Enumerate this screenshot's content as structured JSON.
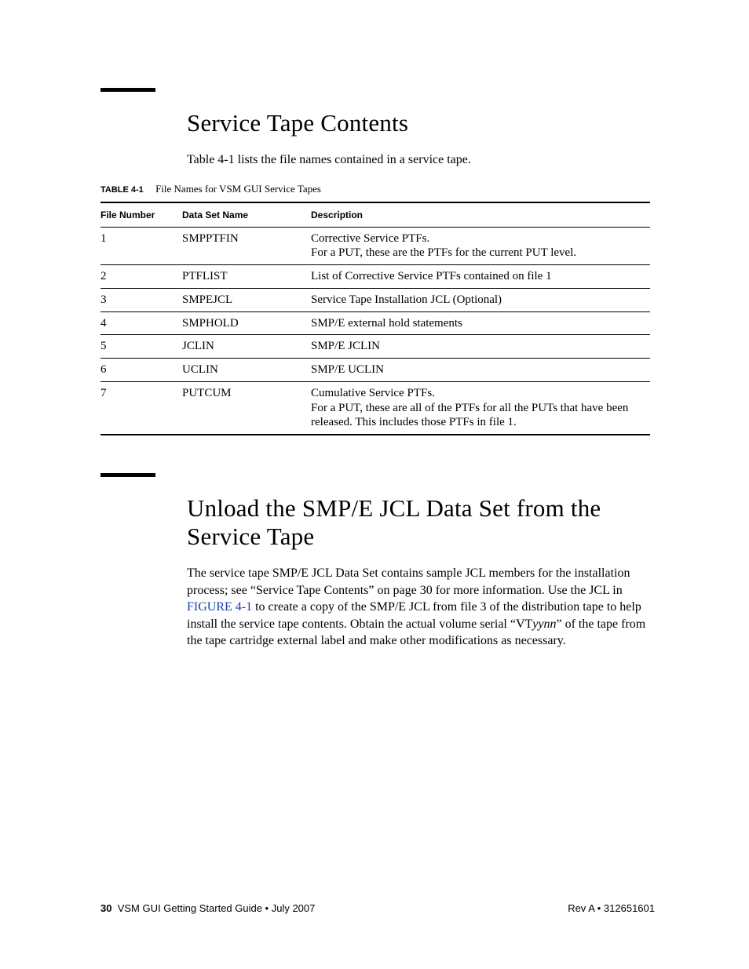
{
  "section1": {
    "title": "Service Tape Contents",
    "intro": "Table 4-1 lists the file names contained in a service tape.",
    "table_label": "TABLE 4-1",
    "table_caption": "File Names for VSM GUI Service Tapes",
    "headers": {
      "num": "File Number",
      "name": "Data Set Name",
      "desc": "Description"
    },
    "rows": [
      {
        "num": "1",
        "name": "SMPPTFIN",
        "desc": "Corrective Service PTFs.\nFor a PUT, these are the PTFs for the current PUT level."
      },
      {
        "num": "2",
        "name": "PTFLIST",
        "desc": "List of Corrective Service PTFs contained on file 1"
      },
      {
        "num": "3",
        "name": "SMPEJCL",
        "desc": "Service Tape Installation JCL (Optional)"
      },
      {
        "num": "4",
        "name": "SMPHOLD",
        "desc": "SMP/E external hold statements"
      },
      {
        "num": "5",
        "name": "JCLIN",
        "desc": "SMP/E JCLIN"
      },
      {
        "num": "6",
        "name": "UCLIN",
        "desc": "SMP/E UCLIN"
      },
      {
        "num": "7",
        "name": "PUTCUM",
        "desc": "Cumulative Service PTFs.\nFor a PUT, these are all of the PTFs for all the PUTs that have been released. This includes those PTFs in file 1."
      }
    ]
  },
  "section2": {
    "title": "Unload the SMP/E JCL Data Set from the Service Tape",
    "para_part1": "The service tape SMP/E JCL Data Set contains sample JCL members for the installation process; see “Service Tape Contents” on page 30 for more information. Use the JCL in ",
    "figure_ref": "FIGURE 4-1",
    "para_part2": " to create a copy of the SMP/E JCL from file 3 of the distribution tape to help install the service tape contents. Obtain the actual volume serial “VT",
    "volser_var": "yynn",
    "para_part3": "” of the tape from the tape cartridge external label and make other modifications as necessary."
  },
  "footer": {
    "page_num": "30",
    "book": "VSM GUI Getting Started Guide  •  July 2007",
    "rev": "Rev A  •  312651601"
  }
}
